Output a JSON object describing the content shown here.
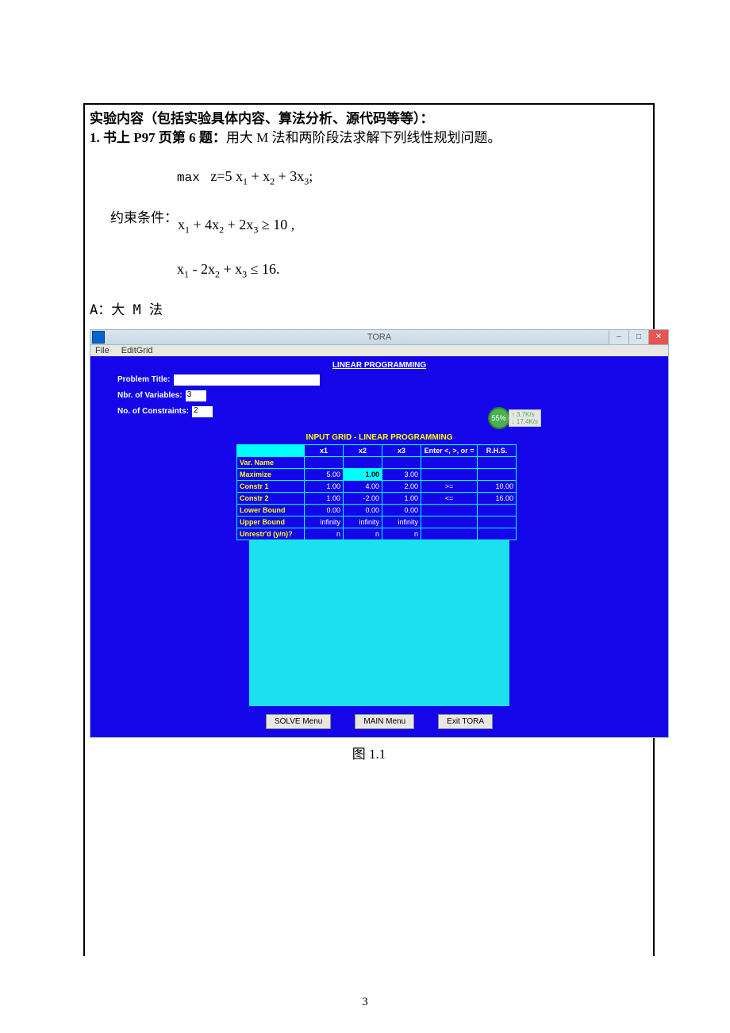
{
  "doc": {
    "heading": "实验内容（包括实验具体内容、算法分析、源代码等等）：",
    "line1a": "1. 书上 P97 页第 6 题：",
    "line1b": "用大 M 法和两阶段法求解下列线性规划问题。",
    "obj_label": "max",
    "constraint_label": "约束条件：",
    "method_a": "A：大 M 法",
    "caption": "图 1.1",
    "page": "3"
  },
  "equations": {
    "obj": "z = 5 x₁ + x₂ + 3 x₃;",
    "c1": "x₁ + 4x₂ + 2x₃ ≥ 10 ,",
    "c2": "x₁ - 2x₂ + x₃ ≤ 16."
  },
  "tora": {
    "window_title": "TORA",
    "menu": {
      "file": "File",
      "editgrid": "EditGrid"
    },
    "lp_heading": "LINEAR PROGRAMMING",
    "labels": {
      "problem_title": "Problem Title:",
      "nbr_vars": "Nbr. of Variables:",
      "nbr_cons": "No. of Constraints:"
    },
    "values": {
      "problem_title": "",
      "nbr_vars": "3",
      "nbr_cons": "2"
    },
    "grid_title": "INPUT GRID - LINEAR PROGRAMMING",
    "headers": {
      "x1": "x1",
      "x2": "x2",
      "x3": "x3",
      "rel": "Enter <, >, or =",
      "rhs": "R.H.S."
    },
    "rows": [
      {
        "lbl": "Var. Name",
        "x1": "",
        "x2": "",
        "x3": "",
        "rel": "",
        "rhs": ""
      },
      {
        "lbl": "Maximize",
        "x1": "5.00",
        "x2": "1.00",
        "x3": "3.00",
        "rel": "",
        "rhs": ""
      },
      {
        "lbl": "Constr 1",
        "x1": "1.00",
        "x2": "4.00",
        "x3": "2.00",
        "rel": ">=",
        "rhs": "10.00"
      },
      {
        "lbl": "Constr 2",
        "x1": "1.00",
        "x2": "-2.00",
        "x3": "1.00",
        "rel": "<=",
        "rhs": "16.00"
      },
      {
        "lbl": "Lower Bound",
        "x1": "0.00",
        "x2": "0.00",
        "x3": "0.00",
        "rel": "",
        "rhs": ""
      },
      {
        "lbl": "Upper Bound",
        "x1": "infinity",
        "x2": "infinity",
        "x3": "infinity",
        "rel": "",
        "rhs": ""
      },
      {
        "lbl": "Unrestr'd (y/n)?",
        "x1": "n",
        "x2": "n",
        "x3": "n",
        "rel": "",
        "rhs": ""
      }
    ],
    "buttons": {
      "solve": "SOLVE Menu",
      "main": "MAIN Menu",
      "exit": "Exit TORA"
    },
    "net": {
      "pct": "55%",
      "up": "↑   3.7K/s",
      "dn": "↓  17.4K/s"
    }
  }
}
